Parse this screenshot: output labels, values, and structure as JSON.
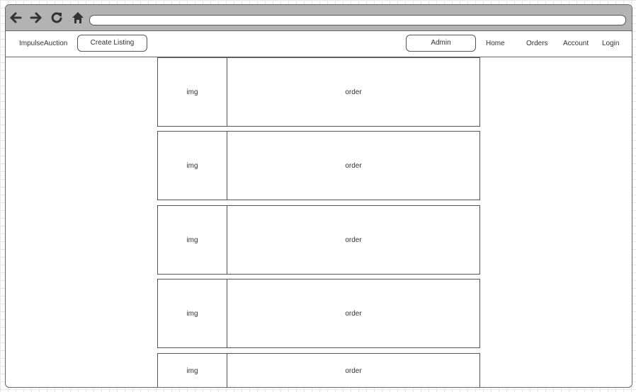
{
  "nav": {
    "brand": "ImpulseAuction",
    "create_listing": "Create Listing",
    "admin": "Admin",
    "home": "Home",
    "orders": "Orders",
    "account": "Account",
    "login": "Login"
  },
  "browser_icons": [
    "arrow-left-icon",
    "arrow-right-icon",
    "reload-icon",
    "home-icon"
  ],
  "orders": [
    {
      "img": "img",
      "label": "order"
    },
    {
      "img": "img",
      "label": "order"
    },
    {
      "img": "img",
      "label": "order"
    },
    {
      "img": "img",
      "label": "order"
    },
    {
      "img": "img",
      "label": "order"
    }
  ]
}
